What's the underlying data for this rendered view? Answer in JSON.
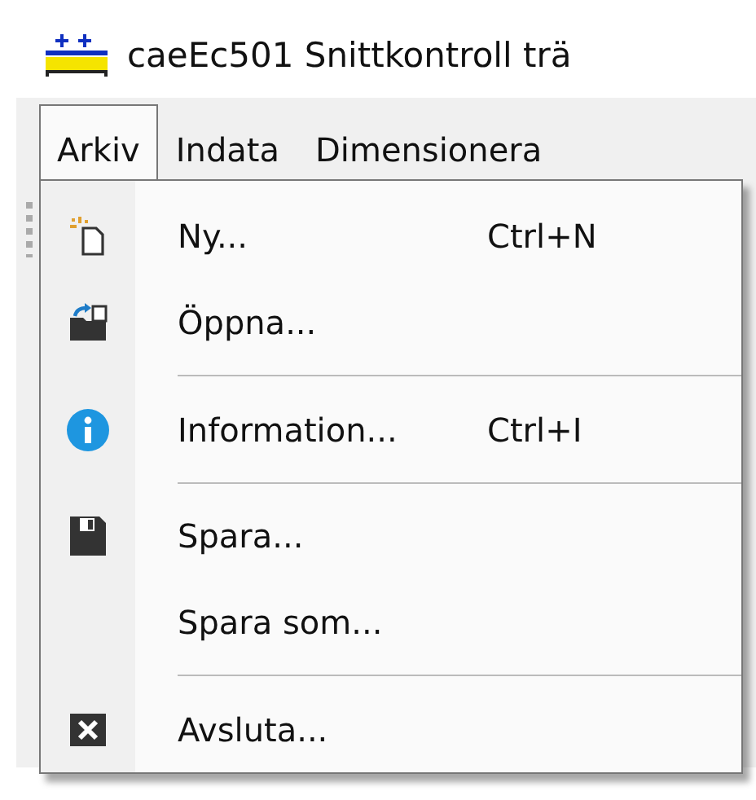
{
  "window": {
    "title": "caeEc501 Snittkontroll trä"
  },
  "menubar": [
    {
      "label": "Arkiv",
      "selected": true
    },
    {
      "label": "Indata",
      "selected": false
    },
    {
      "label": "Dimensionera",
      "selected": false
    }
  ],
  "menu": [
    {
      "kind": "item",
      "label": "Ny...",
      "shortcut": "Ctrl+N"
    },
    {
      "kind": "item",
      "label": "Öppna..."
    },
    {
      "kind": "separator"
    },
    {
      "kind": "item",
      "label": "Information...",
      "shortcut": "Ctrl+I"
    },
    {
      "kind": "separator"
    },
    {
      "kind": "item",
      "label": "Spara..."
    },
    {
      "kind": "item",
      "label": "Spara som..."
    },
    {
      "kind": "separator"
    },
    {
      "kind": "item",
      "label": "Avsluta..."
    }
  ]
}
